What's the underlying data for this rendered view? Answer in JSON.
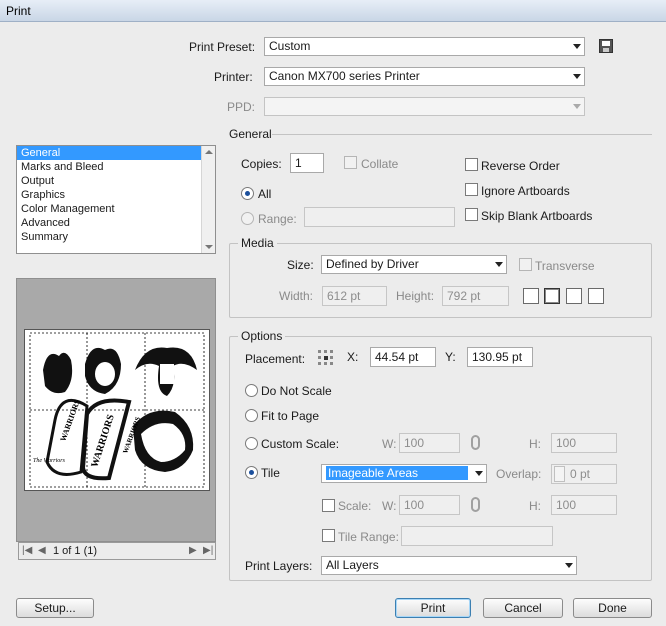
{
  "window": {
    "title": "Print"
  },
  "top": {
    "print_preset_label": "Print Preset:",
    "print_preset_value": "Custom",
    "printer_label": "Printer:",
    "printer_value": "Canon MX700 series Printer",
    "ppd_label": "PPD:",
    "ppd_value": ""
  },
  "sidebar": {
    "items": [
      {
        "label": "General"
      },
      {
        "label": "Marks and Bleed"
      },
      {
        "label": "Output"
      },
      {
        "label": "Graphics"
      },
      {
        "label": "Color Management"
      },
      {
        "label": "Advanced"
      },
      {
        "label": "Summary"
      }
    ],
    "selected": "General"
  },
  "preview": {
    "page_nav": "1 of 1 (1)",
    "artwork_text": [
      "The Warriors",
      "WARRIORS",
      "WARRIORS",
      "WARRIORS"
    ]
  },
  "general": {
    "section_title": "General",
    "copies_label": "Copies:",
    "copies_value": "1",
    "collate_label": "Collate",
    "all_label": "All",
    "range_label": "Range:",
    "range_value": "",
    "reverse_order_label": "Reverse Order",
    "ignore_artboards_label": "Ignore Artboards",
    "skip_blank_label": "Skip Blank Artboards"
  },
  "media": {
    "title": "Media",
    "size_label": "Size:",
    "size_value": "Defined by Driver",
    "transverse_label": "Transverse",
    "width_label": "Width:",
    "width_value": "612 pt",
    "height_label": "Height:",
    "height_value": "792 pt"
  },
  "options": {
    "title": "Options",
    "placement_label": "Placement:",
    "x_label": "X:",
    "x_value": "44.54 pt",
    "y_label": "Y:",
    "y_value": "130.95 pt",
    "do_not_scale_label": "Do Not Scale",
    "fit_to_page_label": "Fit to Page",
    "custom_scale_label": "Custom Scale:",
    "w_label": "W:",
    "w_value": "100",
    "h_label": "H:",
    "h_value": "100",
    "tile_label": "Tile",
    "tile_value": "Imageable Areas",
    "overlap_label": "Overlap:",
    "overlap_value": "0 pt",
    "scale_label": "Scale:",
    "scale_w_value": "100",
    "scale_h_value": "100",
    "tile_range_label": "Tile Range:",
    "tile_range_value": "",
    "print_layers_label": "Print Layers:",
    "print_layers_value": "All Layers"
  },
  "buttons": {
    "setup": "Setup...",
    "print": "Print",
    "cancel": "Cancel",
    "done": "Done"
  },
  "colors": {
    "selection": "#3399ff",
    "accent": "#1b4f9c"
  }
}
